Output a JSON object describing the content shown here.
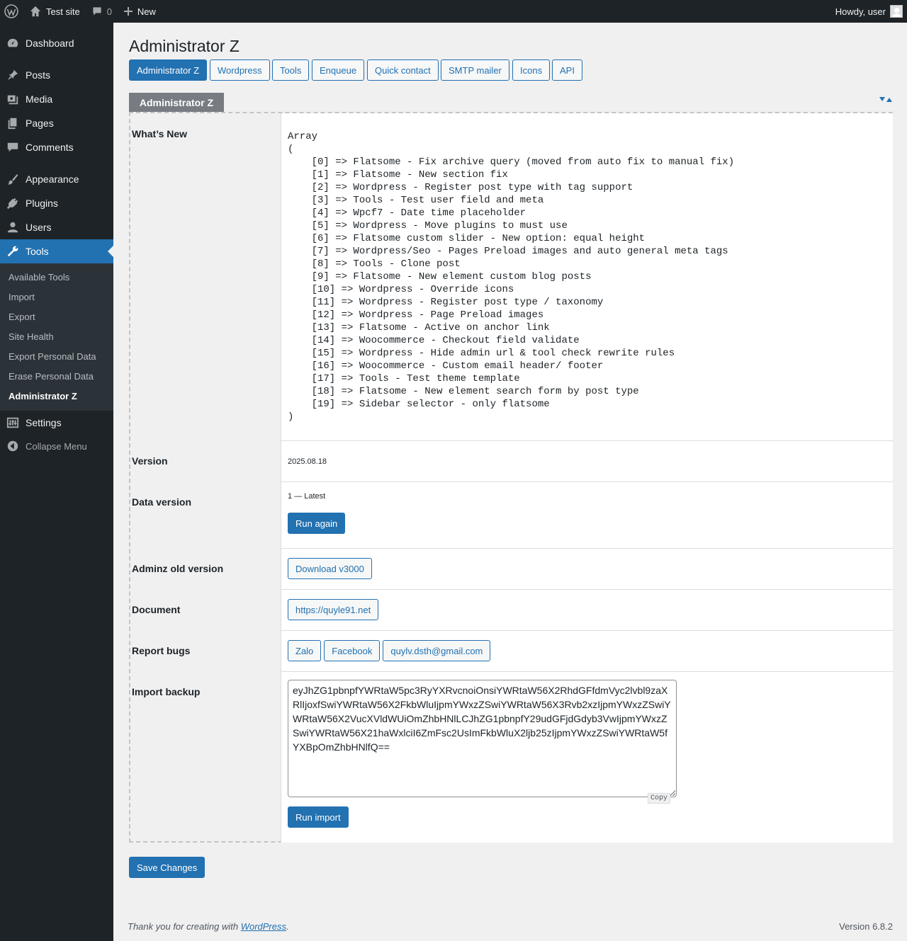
{
  "adminbar": {
    "site_name": "Test site",
    "comments_count": "0",
    "new_label": "New",
    "howdy": "Howdy, user"
  },
  "sidebar": {
    "items": [
      {
        "label": "Dashboard",
        "icon": "dashboard-icon"
      },
      {
        "label": "Posts",
        "icon": "pin-icon"
      },
      {
        "label": "Media",
        "icon": "media-icon"
      },
      {
        "label": "Pages",
        "icon": "pages-icon"
      },
      {
        "label": "Comments",
        "icon": "comment-icon"
      },
      {
        "label": "Appearance",
        "icon": "brush-icon"
      },
      {
        "label": "Plugins",
        "icon": "plug-icon"
      },
      {
        "label": "Users",
        "icon": "user-icon"
      },
      {
        "label": "Tools",
        "icon": "wrench-icon"
      },
      {
        "label": "Settings",
        "icon": "settings-icon"
      }
    ],
    "tools_submenu": [
      "Available Tools",
      "Import",
      "Export",
      "Site Health",
      "Export Personal Data",
      "Erase Personal Data",
      "Administrator Z"
    ],
    "collapse_label": "Collapse Menu"
  },
  "page": {
    "title": "Administrator Z",
    "nav_tabs": [
      "Administrator Z",
      "Wordpress",
      "Tools",
      "Enqueue",
      "Quick contact",
      "SMTP mailer",
      "Icons",
      "API"
    ],
    "section_title": "Administrator Z"
  },
  "rows": {
    "whats_new_label": "What’s New",
    "whats_new_content": "Array\n(\n    [0] => Flatsome - Fix archive query (moved from auto fix to manual fix)\n    [1] => Flatsome - New section fix\n    [2] => Wordpress - Register post type with tag support\n    [3] => Tools - Test user field and meta\n    [4] => Wpcf7 - Date time placeholder\n    [5] => Wordpress - Move plugins to must use\n    [6] => Flatsome custom slider - New option: equal height\n    [7] => Wordpress/Seo - Pages Preload images and auto general meta tags\n    [8] => Tools - Clone post\n    [9] => Flatsome - New element custom blog posts\n    [10] => Wordpress - Override icons\n    [11] => Wordpress - Register post type / taxonomy\n    [12] => Wordpress - Page Preload images\n    [13] => Flatsome - Active on anchor link\n    [14] => Woocommerce - Checkout field validate\n    [15] => Wordpress - Hide admin url & tool check rewrite rules\n    [16] => Woocommerce - Custom email header/ footer\n    [17] => Tools - Test theme template\n    [18] => Flatsome - New element search form by post type\n    [19] => Sidebar selector - only flatsome\n)",
    "version_label": "Version",
    "version_value": "2025.08.18",
    "data_version_label": "Data version",
    "data_version_value": "1 — Latest",
    "run_again": "Run again",
    "old_version_label": "Adminz old version",
    "download_label": "Download v3000",
    "document_label": "Document",
    "document_link": "https://quyle91.net",
    "report_label": "Report bugs",
    "report_links": [
      "Zalo",
      "Facebook",
      "quylv.dsth@gmail.com"
    ],
    "import_label": "Import backup",
    "import_value": "eyJhZG1pbnpfYWRtaW5pc3RyYXRvcnoiOnsiYWRtaW56X2RhdGFfdmVyc2lvbl9zaXRlIjoxfSwiYWRtaW56X2FkbWluIjpmYWxzZSwiYWRtaW56X3Rvb2xzIjpmYWxzZSwiYWRtaW56X2VucXVldWUiOmZhbHNlLCJhZG1pbnpfY29udGFjdGdyb3VwIjpmYWxzZSwiYWRtaW56X21haWxlciI6ZmFsc2UsImFkbWluX2ljb25zIjpmYWxzZSwiYWRtaW5fYXBpOmZhbHNlfQ==",
    "copy_label": "Copy",
    "run_import": "Run import"
  },
  "save_label": "Save Changes",
  "footer": {
    "thanks_prefix": "Thank you for creating with ",
    "thanks_link": "WordPress",
    "thanks_suffix": ".",
    "version": "Version 6.8.2"
  },
  "colors": {
    "accent": "#2271b1",
    "sidebar_bg": "#1d2327",
    "submenu_bg": "#2c3338",
    "section_tab_bg": "#787c82"
  }
}
